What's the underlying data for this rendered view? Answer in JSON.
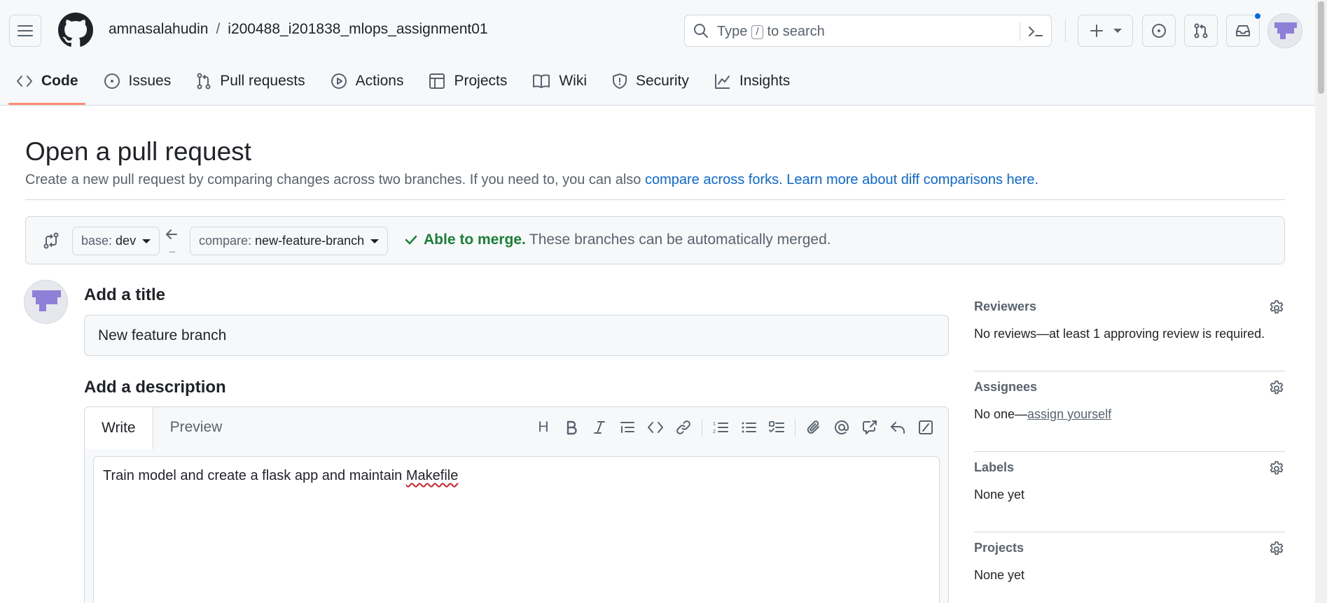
{
  "header": {
    "owner": "amnasalahudin",
    "separator": "/",
    "repo": "i200488_i201838_mlops_assignment01",
    "search": {
      "prefix": "Type",
      "key": "/",
      "suffix": "to search"
    }
  },
  "repo_nav": {
    "tabs": [
      {
        "label": "Code",
        "icon": "code-icon"
      },
      {
        "label": "Issues",
        "icon": "issue-opened-icon"
      },
      {
        "label": "Pull requests",
        "icon": "git-pull-request-icon"
      },
      {
        "label": "Actions",
        "icon": "play-icon"
      },
      {
        "label": "Projects",
        "icon": "table-icon"
      },
      {
        "label": "Wiki",
        "icon": "book-icon"
      },
      {
        "label": "Security",
        "icon": "shield-icon"
      },
      {
        "label": "Insights",
        "icon": "graph-icon"
      }
    ],
    "active": "Code"
  },
  "page": {
    "title": "Open a pull request",
    "subtitle_text": "Create a new pull request by comparing changes across two branches. If you need to, you can also",
    "link_forks": "compare across forks.",
    "link_learn": "Learn more about diff comparisons here."
  },
  "compare": {
    "base_label": "base:",
    "base_value": "dev",
    "compare_label": "compare:",
    "compare_value": "new-feature-branch",
    "arrow_dots": "...",
    "status_ok": "Able to merge.",
    "status_msg": "These branches can be automatically merged."
  },
  "form": {
    "title_heading": "Add a title",
    "title_value": "New feature branch",
    "desc_heading": "Add a description",
    "tab_write": "Write",
    "tab_preview": "Preview",
    "desc_text_before": "Train model and create a flask app and maintain",
    "desc_text_misspelled": "Makefile",
    "toolbar_heading": "H"
  },
  "sidebar": {
    "reviewers": {
      "heading": "Reviewers",
      "body": "No reviews—at least 1 approving review is required."
    },
    "assignees": {
      "heading": "Assignees",
      "body_prefix": "No one—",
      "body_link": "assign yourself"
    },
    "labels": {
      "heading": "Labels",
      "body": "None yet"
    },
    "projects": {
      "heading": "Projects",
      "body": "None yet"
    }
  },
  "colors": {
    "accent_link": "#0969da",
    "success": "#1a7f37",
    "active_tab_underline": "#fd8c73",
    "notification_dot": "#0969da",
    "avatar_purple": "#8e80d9"
  }
}
